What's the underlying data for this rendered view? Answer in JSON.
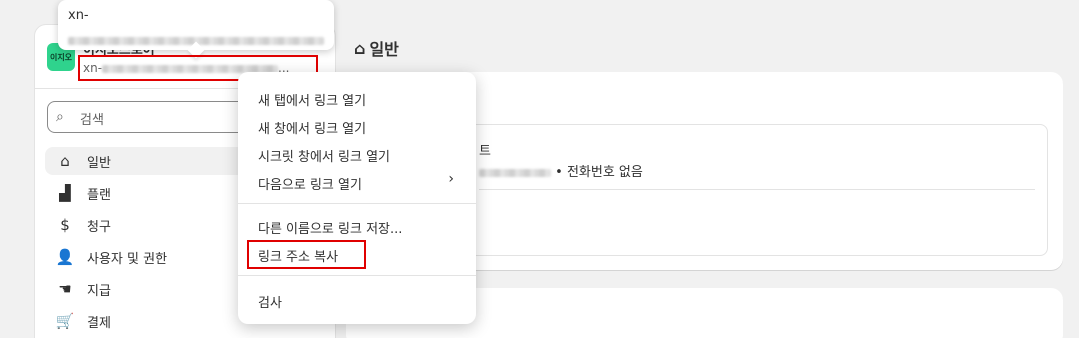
{
  "sidebar": {
    "avatar_text": "이지오",
    "store_name": "이지오스토어",
    "store_url_prefix": "xn-",
    "search_placeholder": "검색",
    "items": [
      {
        "label": "일반",
        "icon": "store-icon"
      },
      {
        "label": "플랜",
        "icon": "plan-icon"
      },
      {
        "label": "청구",
        "icon": "billing-icon"
      },
      {
        "label": "사용자 및 권한",
        "icon": "users-icon"
      },
      {
        "label": "지급",
        "icon": "payout-icon"
      },
      {
        "label": "결제",
        "icon": "cart-icon"
      }
    ]
  },
  "tooltip": {
    "line1": "xn-"
  },
  "main": {
    "title": "일반",
    "store_details_title": "트",
    "phone_text": "• 전화번호 없음"
  },
  "context_menu": {
    "items": [
      "새 탭에서 링크 열기",
      "새 창에서 링크 열기",
      "시크릿 창에서 링크 열기",
      "다음으로 링크 열기",
      "다른 이름으로 링크 저장...",
      "링크 주소 복사",
      "검사"
    ],
    "submenu_arrow": "›"
  }
}
